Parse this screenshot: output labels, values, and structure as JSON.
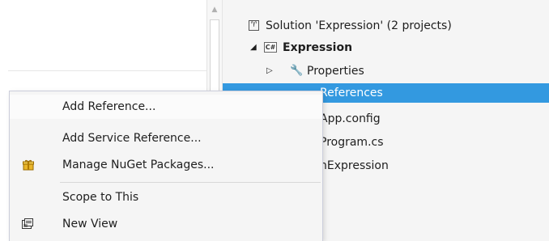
{
  "solution_explorer": {
    "solution_label": "Solution 'Expression' (2 projects)",
    "project_label": "Expression",
    "properties_label": "Properties",
    "references_label": "References",
    "appconfig_label": "App.config",
    "program_label": "Program.cs",
    "other_project_label": "hExpression",
    "cs_badge": "C#"
  },
  "context_menu": {
    "items": [
      {
        "label": "Add Reference...",
        "icon": "none"
      },
      {
        "label": "Add Service Reference...",
        "icon": "none"
      },
      {
        "label": "Manage NuGet Packages...",
        "icon": "nuget-gift-icon"
      },
      {
        "label": "Scope to This",
        "icon": "none"
      },
      {
        "label": "New View",
        "icon": "new-view-icon"
      }
    ]
  },
  "colors": {
    "selection": "#3399e0",
    "menu_background": "#f5f5f5",
    "tree_background": "#f5f5f5"
  }
}
